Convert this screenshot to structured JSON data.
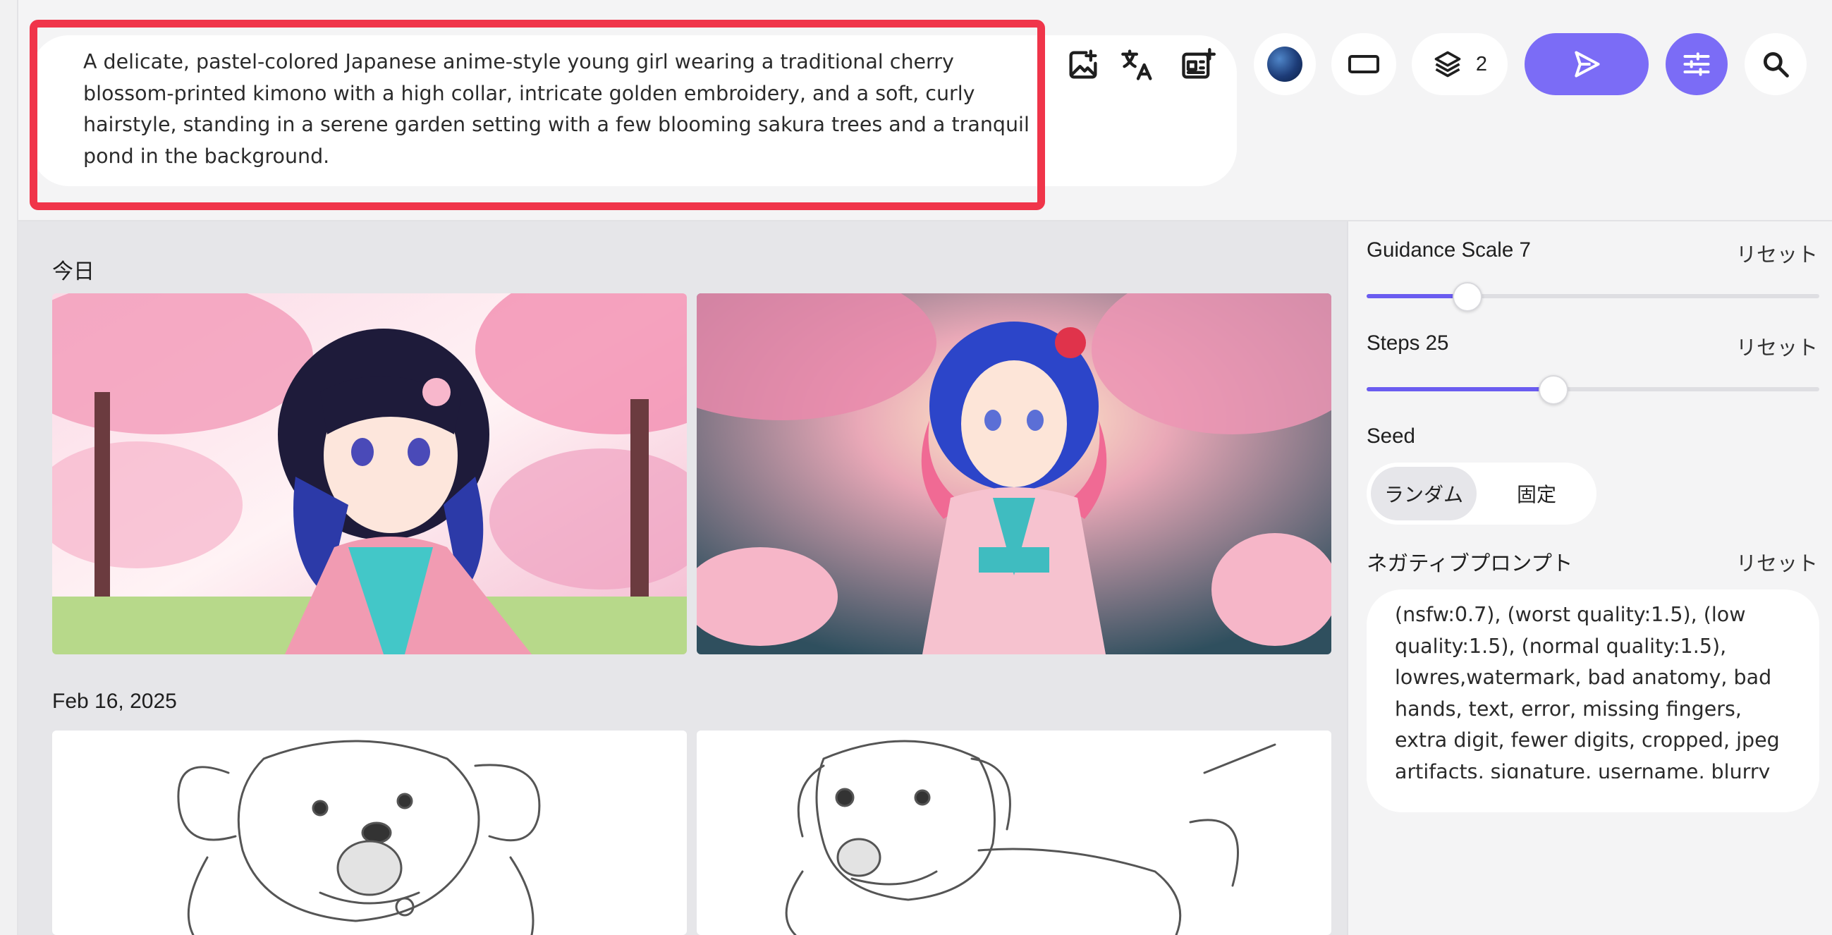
{
  "prompt": {
    "text": "A delicate, pastel-colored Japanese anime-style young girl wearing a traditional cherry blossom-printed kimono with a high collar, intricate golden embroidery, and a soft, curly hairstyle, standing in a serene garden setting with a few blooming sakura trees and a tranquil pond in the background."
  },
  "toolbar": {
    "icons": [
      "add-image-icon",
      "translate-icon",
      "prompt-template-icon",
      "model-avatar-icon",
      "aspect-ratio-icon",
      "layers-icon",
      "send-icon",
      "settings-sliders-icon",
      "search-icon"
    ],
    "layers_count": "2",
    "accent_color": "#7b6cf6"
  },
  "gallery": {
    "groups": [
      {
        "date": "今日",
        "images": [
          "anime-girl-kimono-black-hair",
          "anime-girl-kimono-blue-hair"
        ]
      },
      {
        "date": "Feb 16, 2025",
        "images": [
          "dog-sketch-running-left",
          "dog-sketch-running-right"
        ]
      }
    ]
  },
  "settings": {
    "guidance": {
      "label": "Guidance Scale 7",
      "reset": "リセット",
      "value": 7,
      "fraction": 0.22
    },
    "steps": {
      "label": "Steps 25",
      "reset": "リセット",
      "value": 25,
      "fraction": 0.41
    },
    "seed": {
      "label": "Seed",
      "options": [
        "ランダム",
        "固定"
      ],
      "selected": "ランダム"
    },
    "negative": {
      "label": "ネガティブプロンプト",
      "reset": "リセット",
      "text": "(nsfw:0.7), (worst quality:1.5), (low quality:1.5), (normal quality:1.5), lowres,watermark, bad anatomy, bad hands, text, error, missing fingers, extra digit, fewer digits, cropped, jpeg artifacts, signature, username, blurry"
    }
  }
}
